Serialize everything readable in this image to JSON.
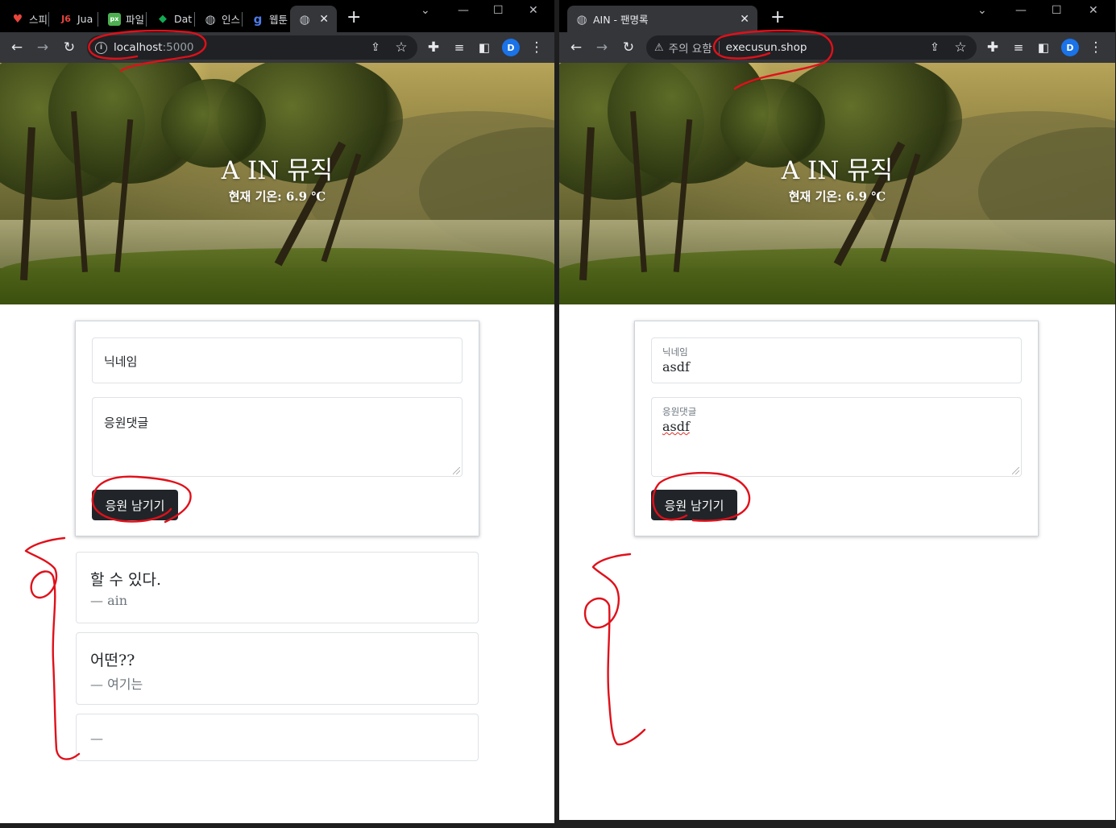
{
  "left_window": {
    "tabs": [
      {
        "label": "스피",
        "icon": "heart-icon",
        "color": "#e8453c"
      },
      {
        "label": "Jua",
        "icon": "jua-logo-icon",
        "color": "#e8453c"
      },
      {
        "label": "파일",
        "icon": "px-icon",
        "color": "#4caf50"
      },
      {
        "label": "Dat",
        "icon": "leaf-icon",
        "color": "#13aa52"
      },
      {
        "label": "인스",
        "icon": "globe-icon",
        "color": "#bdc1c6"
      },
      {
        "label": "웹툰",
        "icon": "g-icon",
        "color": "#4f7be8"
      }
    ],
    "active_tab": {
      "label": "",
      "icon": "globe-icon"
    },
    "address": {
      "host": "localhost",
      "port": ":5000"
    },
    "profile_initial": "D",
    "page": {
      "title": "A IN 뮤직",
      "weather": "현재 기온: 6.9 ℃",
      "form": {
        "nickname_placeholder": "닉네임",
        "comment_placeholder": "응원댓글",
        "submit_label": "응원 남기기"
      },
      "comments": [
        {
          "quote": "할 수 있다.",
          "author": "— ain"
        },
        {
          "quote": "어떤??",
          "author": "— 여기는"
        },
        {
          "quote": "",
          "author": "—"
        }
      ]
    }
  },
  "right_window": {
    "tab": {
      "label": "AIN - 팬명록",
      "icon": "globe-icon"
    },
    "address": {
      "warning_label": "주의 요함",
      "host": "execusun.shop"
    },
    "profile_initial": "D",
    "page": {
      "title": "A IN 뮤직",
      "weather": "현재 기온: 6.9 ℃",
      "form": {
        "nickname_label": "닉네임",
        "nickname_value": "asdf",
        "comment_label": "응원댓글",
        "comment_value": "asdf",
        "submit_label": "응원 남기기"
      }
    }
  },
  "colors": {
    "annotation": "#e0101a",
    "button_bg": "#212529",
    "chrome_toolbar": "#35363a",
    "chrome_tabbar": "#000000"
  }
}
